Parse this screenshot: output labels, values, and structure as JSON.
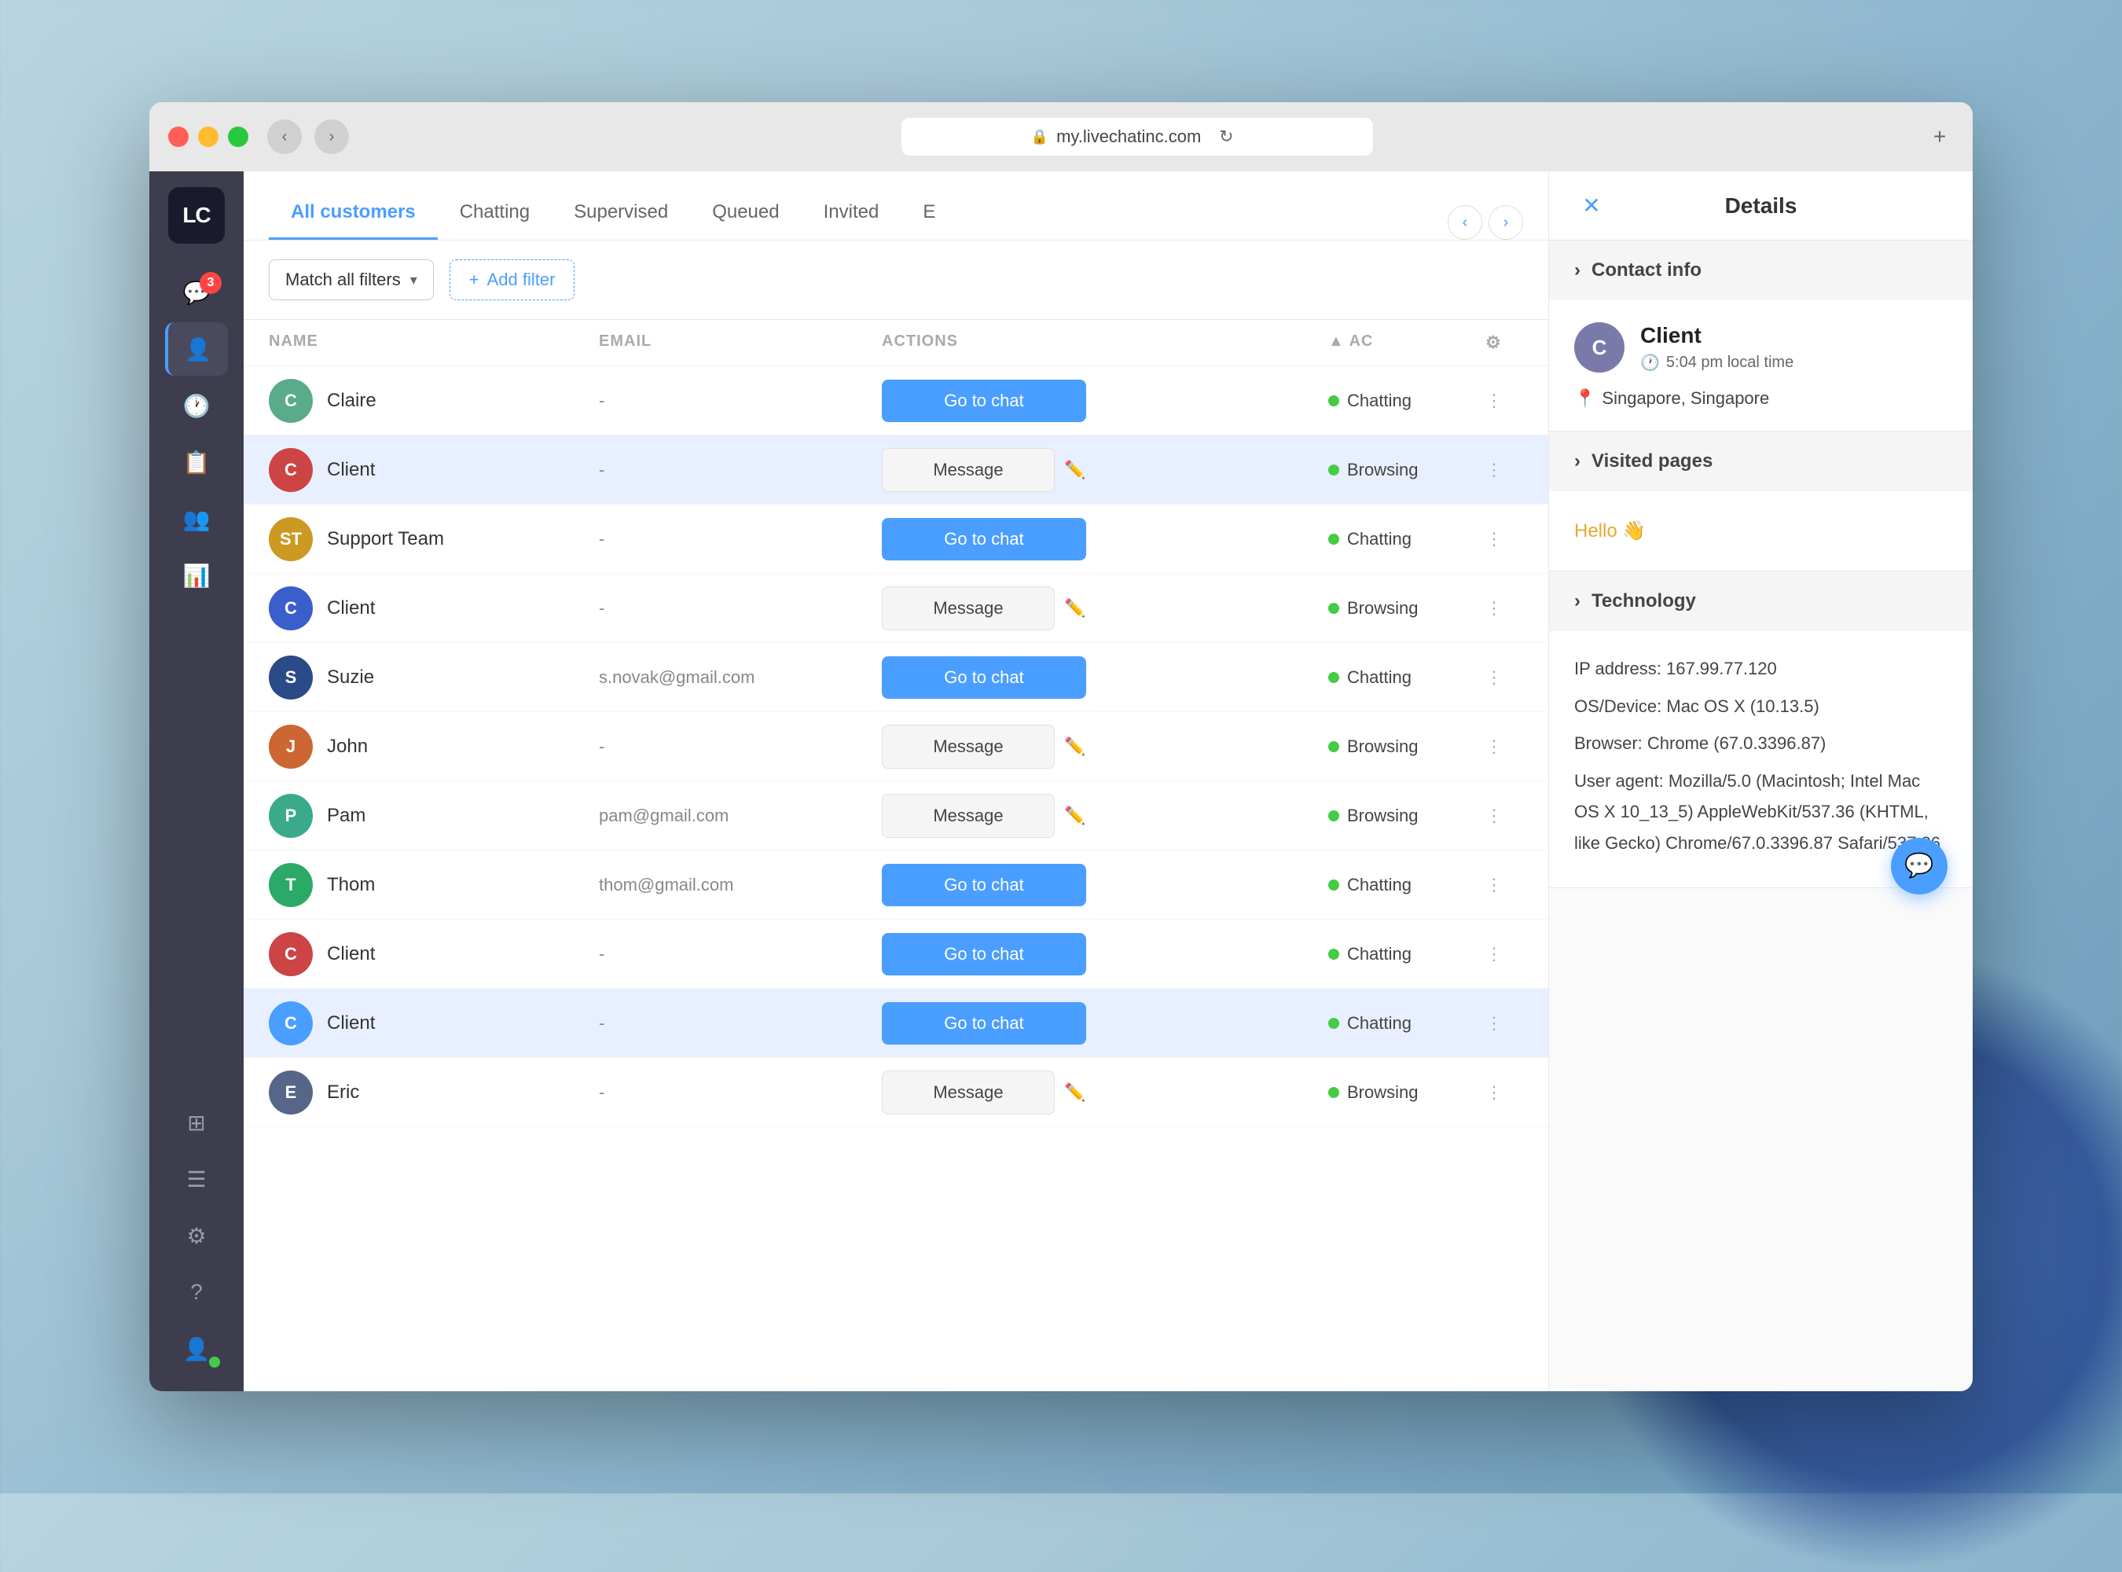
{
  "browser": {
    "url": "my.livechatinc.com",
    "back_label": "‹",
    "forward_label": "›",
    "refresh_label": "↻",
    "new_tab_label": "+"
  },
  "sidebar": {
    "logo": "LC",
    "items": [
      {
        "id": "chat",
        "icon": "💬",
        "badge": "3",
        "label": "Chat"
      },
      {
        "id": "customers",
        "icon": "👤",
        "label": "Customers",
        "active": true
      },
      {
        "id": "history",
        "icon": "🕐",
        "label": "History"
      },
      {
        "id": "reports",
        "icon": "📊",
        "label": "Reports"
      },
      {
        "id": "team",
        "icon": "👥",
        "label": "Team"
      },
      {
        "id": "stats",
        "icon": "📈",
        "label": "Stats"
      }
    ],
    "bottom_items": [
      {
        "id": "grid",
        "icon": "⊞",
        "label": "Grid"
      },
      {
        "id": "menu",
        "icon": "☰",
        "label": "Menu"
      },
      {
        "id": "settings",
        "icon": "⚙",
        "label": "Settings"
      },
      {
        "id": "help",
        "icon": "?",
        "label": "Help"
      },
      {
        "id": "profile",
        "icon": "👤",
        "label": "Profile",
        "online": true
      }
    ]
  },
  "tabs": {
    "items": [
      {
        "id": "all",
        "label": "All customers",
        "active": true
      },
      {
        "id": "chatting",
        "label": "Chatting"
      },
      {
        "id": "supervised",
        "label": "Supervised"
      },
      {
        "id": "queued",
        "label": "Queued"
      },
      {
        "id": "invited",
        "label": "Invited"
      },
      {
        "id": "more",
        "label": "E"
      }
    ],
    "nav_prev": "‹",
    "nav_next": "›"
  },
  "filter": {
    "match_label": "Match all filters",
    "chevron": "▾",
    "add_label": "Add filter",
    "add_icon": "+"
  },
  "table": {
    "columns": {
      "name": "NAME",
      "email": "EMAIL",
      "actions": "ACTIONS",
      "sort_icon": "▲"
    },
    "rows": [
      {
        "id": 1,
        "avatar_letter": "C",
        "avatar_color": "#5aab8a",
        "name": "Claire",
        "email": "-",
        "action": "go_chat",
        "action_label": "Go to chat",
        "status": "Chatting",
        "highlighted": false
      },
      {
        "id": 2,
        "avatar_letter": "C",
        "avatar_color": "#cc4444",
        "name": "Client",
        "email": "-",
        "action": "message",
        "action_label": "Message",
        "status": "Browsing",
        "highlighted": true
      },
      {
        "id": 3,
        "avatar_letter": "ST",
        "avatar_color": "#cc9922",
        "name": "Support Team",
        "email": "-",
        "action": "go_chat",
        "action_label": "Go to chat",
        "status": "Chatting",
        "highlighted": false
      },
      {
        "id": 4,
        "avatar_letter": "C",
        "avatar_color": "#3a5fcc",
        "name": "Client",
        "email": "-",
        "action": "message",
        "action_label": "Message",
        "status": "Browsing",
        "highlighted": false
      },
      {
        "id": 5,
        "avatar_letter": "S",
        "avatar_color": "#2a4a88",
        "name": "Suzie",
        "email": "s.novak@gmail.com",
        "action": "go_chat",
        "action_label": "Go to chat",
        "status": "Chatting",
        "highlighted": false
      },
      {
        "id": 6,
        "avatar_letter": "J",
        "avatar_color": "#cc6633",
        "name": "John",
        "email": "-",
        "action": "message",
        "action_label": "Message",
        "status": "Browsing",
        "highlighted": false
      },
      {
        "id": 7,
        "avatar_letter": "P",
        "avatar_color": "#3aaa8a",
        "name": "Pam",
        "email": "pam@gmail.com",
        "action": "message",
        "action_label": "Message",
        "status": "Browsing",
        "highlighted": false
      },
      {
        "id": 8,
        "avatar_letter": "T",
        "avatar_color": "#2aaa66",
        "name": "Thom",
        "email": "thom@gmail.com",
        "action": "go_chat",
        "action_label": "Go to chat",
        "status": "Chatting",
        "highlighted": false
      },
      {
        "id": 9,
        "avatar_letter": "C",
        "avatar_color": "#cc4444",
        "name": "Client",
        "email": "-",
        "action": "go_chat",
        "action_label": "Go to chat",
        "status": "Chatting",
        "highlighted": false
      },
      {
        "id": 10,
        "avatar_letter": "C",
        "avatar_color": "#4a9eff",
        "name": "Client",
        "email": "-",
        "action": "go_chat",
        "action_label": "Go to chat",
        "status": "Chatting",
        "highlighted": true
      },
      {
        "id": 11,
        "avatar_letter": "E",
        "avatar_color": "#556688",
        "name": "Eric",
        "email": "-",
        "action": "message",
        "action_label": "Message",
        "status": "Browsing",
        "highlighted": false
      }
    ]
  },
  "details": {
    "title": "Details",
    "close_icon": "✕",
    "sections": {
      "contact": {
        "label": "Contact info",
        "chevron": "›",
        "client": {
          "name": "Client",
          "avatar_letter": "C",
          "time": "5:04 pm local time",
          "location": "Singapore, Singapore"
        }
      },
      "visited": {
        "label": "Visited pages",
        "chevron": "›",
        "url": "Hello 👋"
      },
      "technology": {
        "label": "Technology",
        "chevron": "›",
        "ip": "IP address: 167.99.77.120",
        "os": "OS/Device: Mac OS X (10.13.5)",
        "browser": "Browser: Chrome (67.0.3396.87)",
        "user_agent": "User agent: Mozilla/5.0 (Macintosh; Intel Mac OS X 10_13_5) AppleWebKit/537.36 (KHTML, like Gecko) Chrome/67.0.3396.87 Safari/537.36"
      }
    }
  }
}
